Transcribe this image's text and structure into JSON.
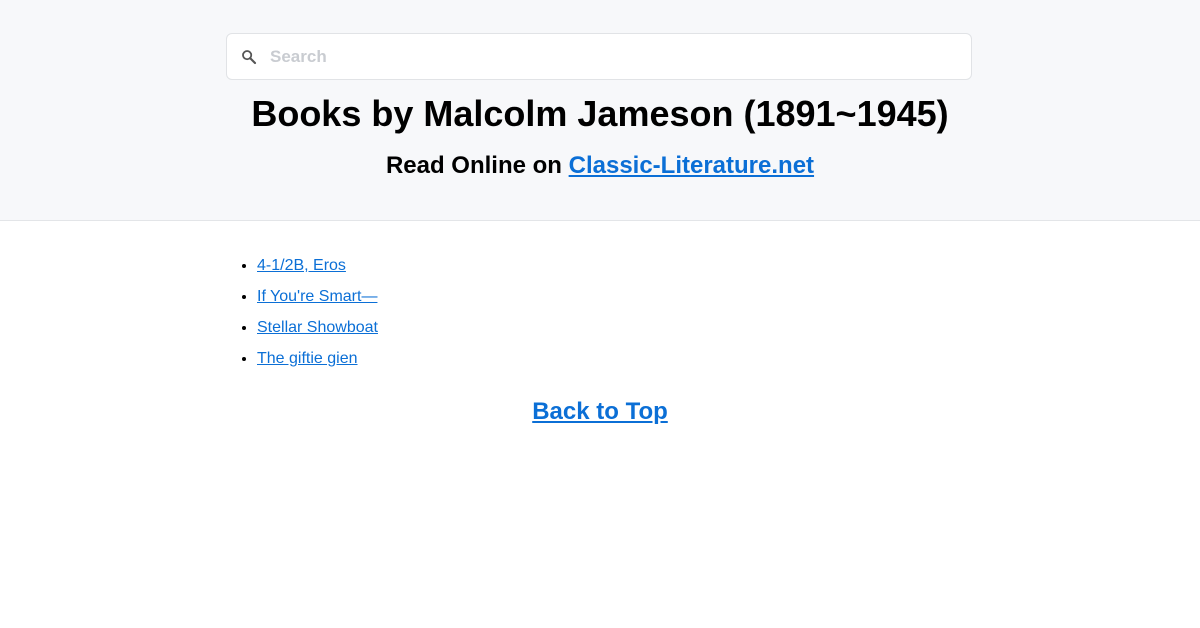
{
  "search": {
    "placeholder": "Search",
    "icon": "search-icon"
  },
  "header": {
    "title": "Books by Malcolm Jameson (1891~1945)",
    "subtitle_prefix": "Read Online on ",
    "site_link": "Classic-Literature.net"
  },
  "books": [
    {
      "title": "4-1/2B, Eros"
    },
    {
      "title": "If You're Smart—"
    },
    {
      "title": "Stellar Showboat"
    },
    {
      "title": "The giftie gien"
    }
  ],
  "footer": {
    "back_to_top": "Back to Top"
  },
  "colors": {
    "link": "#0b6fd6",
    "header_bg": "#f7f8fa"
  }
}
